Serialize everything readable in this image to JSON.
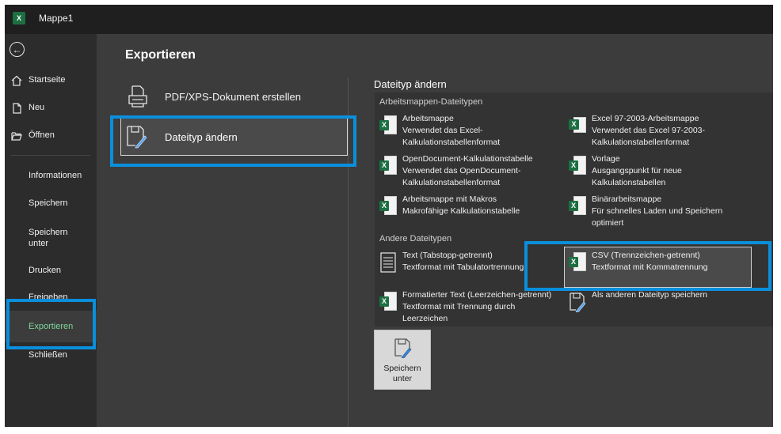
{
  "window": {
    "app_icon": "X",
    "title": "Mappe1"
  },
  "sidebar": {
    "back_icon": "arrow-left-circle-icon",
    "items": [
      {
        "label": "Startseite",
        "icon": "home-icon"
      },
      {
        "label": "Neu",
        "icon": "new-document-icon"
      },
      {
        "label": "Öffnen",
        "icon": "folder-open-icon"
      },
      {
        "label": "Informationen"
      },
      {
        "label": "Speichern"
      },
      {
        "label": "Speichern unter"
      },
      {
        "label": "Drucken"
      },
      {
        "label": "Freigeben"
      },
      {
        "label": "Exportieren"
      },
      {
        "label": "Schließen"
      }
    ],
    "active": "Exportieren",
    "active_color": "#7ed69b"
  },
  "main": {
    "title": "Exportieren",
    "options": [
      {
        "label": "PDF/XPS-Dokument erstellen",
        "icon": "pdf-document-icon"
      },
      {
        "label": "Dateityp ändern",
        "icon": "change-file-type-icon"
      }
    ]
  },
  "filetypes": {
    "section_title": "Dateityp ändern",
    "group1_title": "Arbeitsmappen-Dateitypen",
    "group2_title": "Andere Dateitypen",
    "items": [
      {
        "name": "Arbeitsmappe",
        "desc": "Verwendet das Excel-Kalkulationstabellenformat",
        "icon": "excel-workbook-icon"
      },
      {
        "name": "Excel 97-2003-Arbeitsmappe",
        "desc": "Verwendet das Excel 97-2003-Kalkulationstabellenformat",
        "icon": "excel-97-icon"
      },
      {
        "name": "OpenDocument-Kalkulationstabelle",
        "desc": "Verwendet das OpenDocument-Kalkulationstabellenformat",
        "icon": "opendocument-spreadsheet-icon"
      },
      {
        "name": "Vorlage",
        "desc": "Ausgangspunkt für neue Kalkulationstabellen",
        "icon": "excel-template-icon"
      },
      {
        "name": "Arbeitsmappe mit Makros",
        "desc": "Makrofähige Kalkulationstabelle",
        "icon": "excel-macro-icon"
      },
      {
        "name": "Binärarbeitsmappe",
        "desc": "Für schnelles Laden und Speichern optimiert",
        "icon": "excel-binary-icon"
      },
      {
        "name": "Text (Tabstopp-getrennt)",
        "desc": "Textformat mit Tabulatortrennung",
        "icon": "text-file-icon"
      },
      {
        "name": "CSV (Trennzeichen-getrennt)",
        "desc": "Textformat mit Kommatrennung",
        "icon": "csv-file-icon"
      },
      {
        "name": "Formatierter Text (Leerzeichen-getrennt)",
        "desc": "Textformat mit Trennung durch Leerzeichen",
        "icon": "formatted-text-icon"
      },
      {
        "name": "Als anderen Dateityp speichern",
        "desc": "",
        "icon": "save-as-other-icon"
      }
    ]
  },
  "save_button": {
    "label": "Speichern unter",
    "icon": "save-as-icon"
  },
  "colors": {
    "highlight": "#0a8fdc",
    "excel_green": "#1d6f42"
  }
}
